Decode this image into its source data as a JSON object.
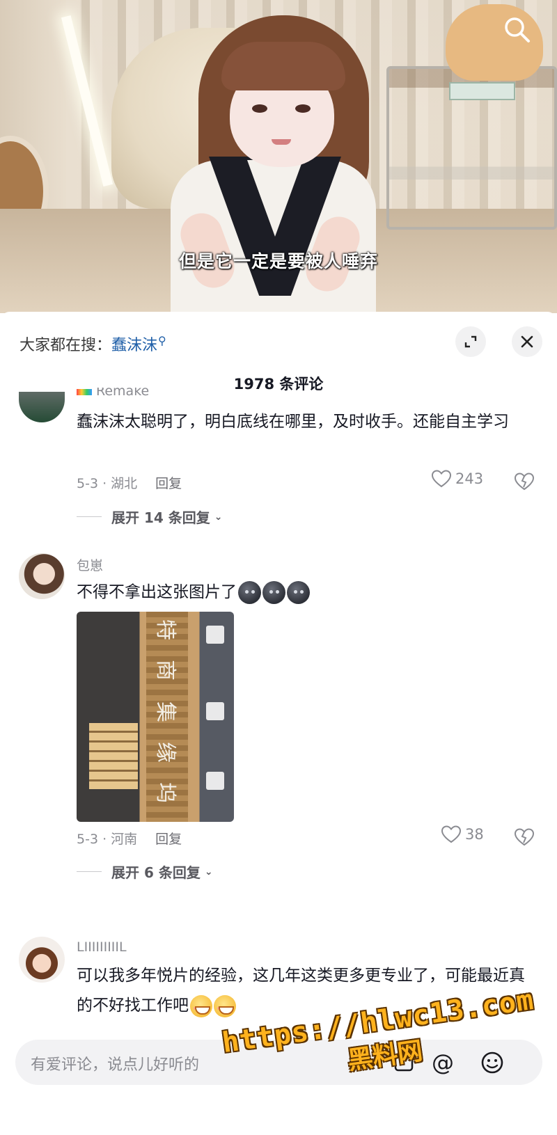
{
  "video": {
    "subtitle": "但是它一定是要被人唾弃"
  },
  "sheet": {
    "trend_prefix": "大家都在搜：",
    "trend_keyword": "蠢沫沫",
    "comment_count": "1978 条评论"
  },
  "comments": [
    {
      "name": "Remake",
      "text": "蠢沫沫太聪明了，明白底线在哪里，及时收手。还能自主学习",
      "date_location": "5-3 · 湖北",
      "reply_label": "回复",
      "likes": "243",
      "expand_label": "展开 14 条回复"
    },
    {
      "name": "包崽",
      "text": "不得不拿出这张图片了",
      "date_location": "5-3 · 河南",
      "reply_label": "回复",
      "likes": "38",
      "expand_label": "展开 6 条回复",
      "photo_chars": [
        "特",
        "商",
        "集",
        "缘",
        "坞"
      ]
    },
    {
      "name": "LIIIIIIIIIL",
      "text": "可以我多年悦片的经验，这几年这类更多更专业了，可能最近真的不好找工作吧",
      "date_location": "",
      "reply_label": "",
      "likes": "",
      "expand_label": ""
    }
  ],
  "input": {
    "placeholder": "有爱评论，说点儿好听的"
  },
  "watermark": {
    "url": "https://hlwc13.com",
    "site": "黑料网"
  },
  "colors": {
    "keyword": "#1f5fa8",
    "meta": "#8a8b91",
    "watermark": "#ffb21d"
  }
}
